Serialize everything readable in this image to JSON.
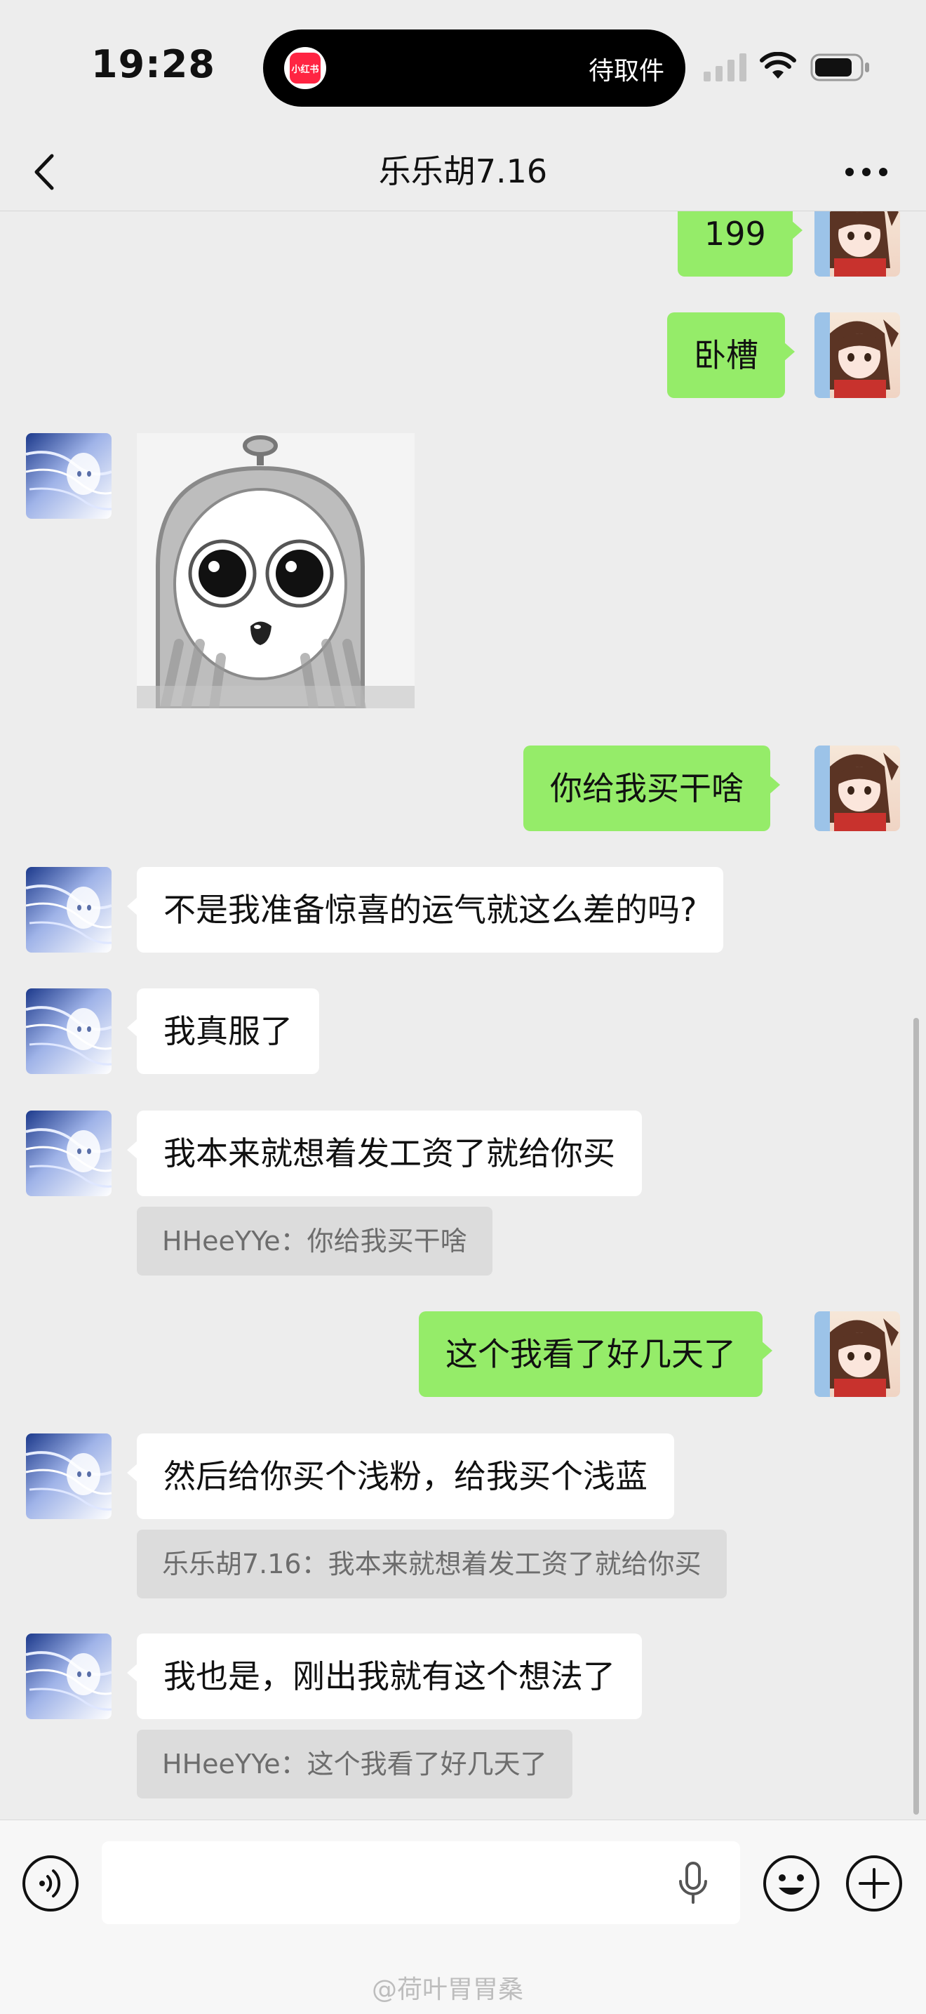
{
  "status_bar": {
    "time": "19:28",
    "island_app_label": "小红书",
    "island_text": "待取件"
  },
  "nav": {
    "title": "乐乐胡7.16"
  },
  "messages": [
    {
      "side": "right",
      "text": "199"
    },
    {
      "side": "right",
      "text": "卧槽"
    },
    {
      "side": "left",
      "type": "sticker"
    },
    {
      "side": "right",
      "text": "你给我买干啥"
    },
    {
      "side": "left",
      "text": "不是我准备惊喜的运气就这么差的吗?"
    },
    {
      "side": "left",
      "text": "我真服了"
    },
    {
      "side": "left",
      "text": "我本来就想着发工资了就给你买",
      "quote": "HHeeYYe：你给我买干啥"
    },
    {
      "side": "right",
      "text": "这个我看了好几天了"
    },
    {
      "side": "left",
      "text": "然后给你买个浅粉，给我买个浅蓝",
      "quote": "乐乐胡7.16：我本来就想着发工资了就给你买"
    },
    {
      "side": "left",
      "text": "我也是，刚出我就有这个想法了",
      "quote": "HHeeYYe：这个我看了好几天了"
    }
  ],
  "input": {
    "value": "",
    "placeholder": ""
  },
  "watermark": "@荷叶胃胃桑",
  "icons": [
    "back-icon",
    "more-icon",
    "voice-icon",
    "mic-icon",
    "emoji-icon",
    "plus-icon",
    "signal-icon",
    "wifi-icon",
    "battery-icon"
  ],
  "colors": {
    "background": "#ededed",
    "sent_bubble": "#95ec69",
    "received_bubble": "#ffffff",
    "quote_bg": "#dcdcdc",
    "brand_red": "#ff2442"
  }
}
